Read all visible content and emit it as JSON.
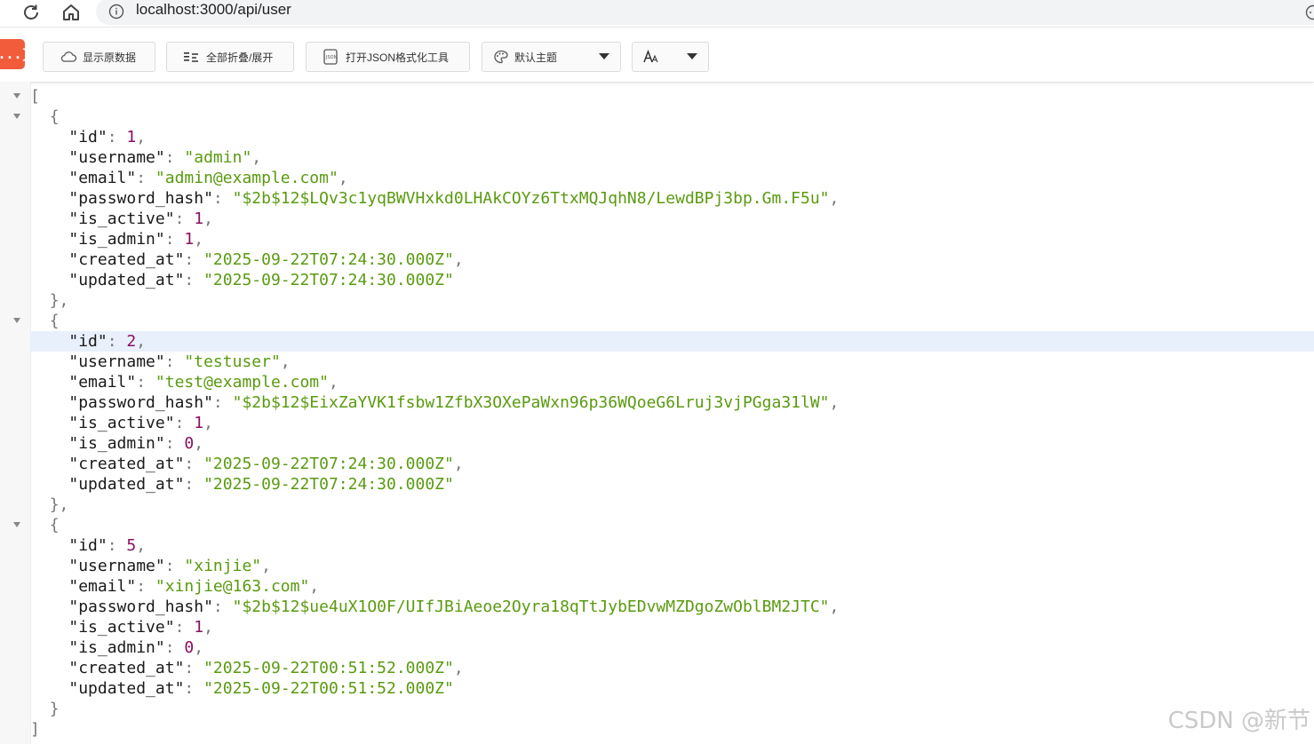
{
  "browser": {
    "url": "localhost:3000/api/user"
  },
  "toolbar": {
    "logo": "{...}",
    "raw_label": "显示原数据",
    "fold_label": "全部折叠/展开",
    "formatter_label": "打开JSON格式化工具",
    "theme_label": "默认主题",
    "font_label": "AA"
  },
  "colors": {
    "string": "#5a9a10",
    "number": "#8a1060",
    "key": "#1a1a1a",
    "punctuation": "#777777",
    "logo_bg": "#f25c3b",
    "highlight_row": "#e8f0fb"
  },
  "json_punct": {
    "open_array": "[",
    "close_array": "]",
    "open_obj": "{",
    "close_obj": "}",
    "close_obj_comma": "},",
    "colon": ": ",
    "comma": ","
  },
  "users": [
    {
      "id": "1",
      "username": "\"admin\"",
      "email": "\"admin@example.com\"",
      "password_hash": "\"$2b$12$LQv3c1yqBWVHxkd0LHAkCOYz6TtxMQJqhN8/LewdBPj3bp.Gm.F5u\"",
      "is_active": "1",
      "is_admin": "1",
      "created_at": "\"2025-09-22T07:24:30.000Z\"",
      "updated_at": "\"2025-09-22T07:24:30.000Z\""
    },
    {
      "id": "2",
      "username": "\"testuser\"",
      "email": "\"test@example.com\"",
      "password_hash": "\"$2b$12$EixZaYVK1fsbw1ZfbX3OXePaWxn96p36WQoeG6Lruj3vjPGga31lW\"",
      "is_active": "1",
      "is_admin": "0",
      "created_at": "\"2025-09-22T07:24:30.000Z\"",
      "updated_at": "\"2025-09-22T07:24:30.000Z\""
    },
    {
      "id": "5",
      "username": "\"xinjie\"",
      "email": "\"xinjie@163.com\"",
      "password_hash": "\"$2b$12$ue4uX1O0F/UIfJBiAeoe2Oyra18qTtJybEDvwMZDgoZwOblBM2JTC\"",
      "is_active": "1",
      "is_admin": "0",
      "created_at": "\"2025-09-22T00:51:52.000Z\"",
      "updated_at": "\"2025-09-22T00:51:52.000Z\""
    }
  ],
  "keys": {
    "id": "\"id\"",
    "username": "\"username\"",
    "email": "\"email\"",
    "password_hash": "\"password_hash\"",
    "is_active": "\"is_active\"",
    "is_admin": "\"is_admin\"",
    "created_at": "\"created_at\"",
    "updated_at": "\"updated_at\""
  },
  "watermark": "CSDN @新节"
}
